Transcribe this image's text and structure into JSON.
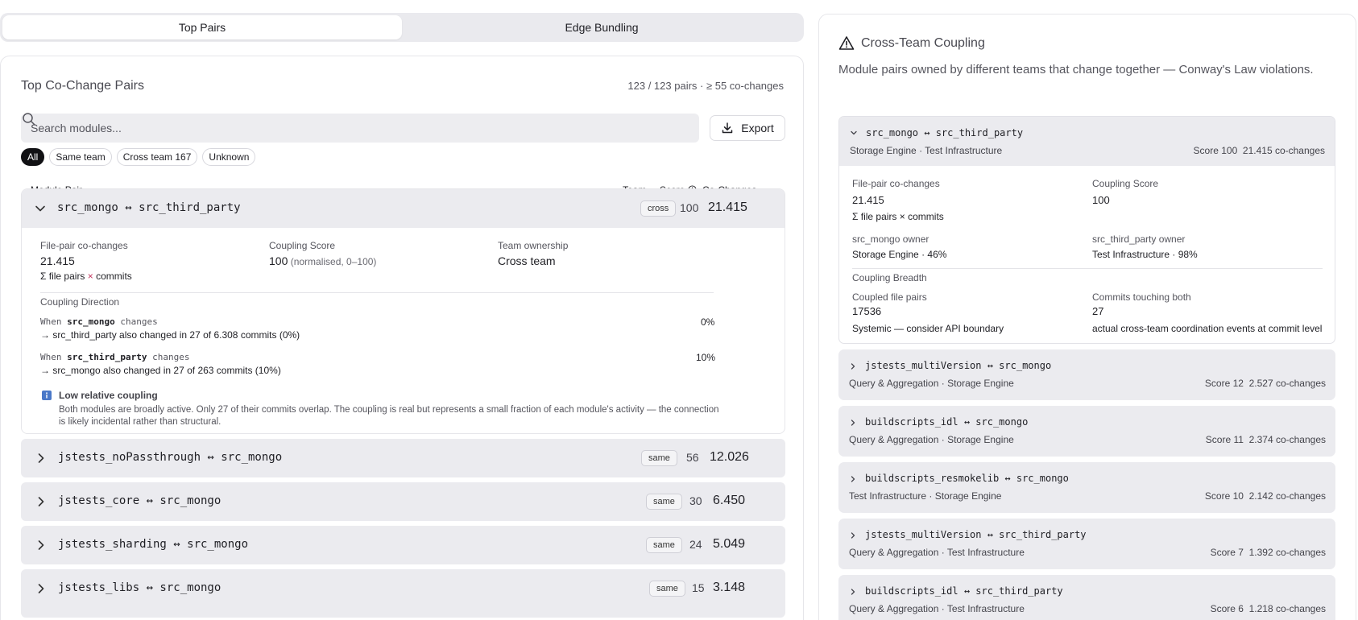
{
  "tabs": [
    {
      "label": "Top Pairs",
      "active": true
    },
    {
      "label": "Edge Bundling",
      "active": false
    }
  ],
  "main": {
    "title": "Top Co-Change Pairs",
    "meta": "123 / 123 pairs · ≥ 55 co-changes",
    "search_placeholder": "Search modules...",
    "export_label": "Export",
    "filters": [
      "All",
      "Same team",
      "Cross team 167",
      "Unknown"
    ],
    "columns": {
      "pair": "Module Pair",
      "team": "Team",
      "score": "Score",
      "cochanges": "Co-Changes"
    },
    "expanded": {
      "pair": "src_mongo ↔ src_third_party",
      "team": "cross",
      "score": "100",
      "cochanges": "21.415",
      "file_pair_label": "File-pair co-changes",
      "file_pair_value": "21.415",
      "file_pair_sub_a": "Σ file pairs ",
      "file_pair_sub_x": "×",
      "file_pair_sub_b": " commits",
      "coupling_label": "Coupling Score",
      "coupling_value": "100",
      "coupling_note": " (normalised, 0–100)",
      "ownership_label": "Team ownership",
      "ownership_value": "Cross team",
      "direction_label": "Coupling Direction",
      "dir1_when": "When ",
      "dir1_module": "src_mongo",
      "dir1_changes": " changes",
      "dir1_detail": "→ src_third_party also changed in 27 of 6.308 commits (0%)",
      "dir1_pct": "0%",
      "dir2_when": "When ",
      "dir2_module": "src_third_party",
      "dir2_changes": " changes",
      "dir2_detail": "→ src_mongo also changed in 27 of 263 commits (10%)",
      "dir2_pct": "10%",
      "note_title": "Low relative coupling",
      "note_body": "Both modules are broadly active. Only 27 of their commits overlap. The coupling is real but represents a small fraction of each module's activity — the connection is likely incidental rather than structural."
    },
    "rows": [
      {
        "pair": "jstests_noPassthrough ↔ src_mongo",
        "team": "same",
        "score": "56",
        "cochanges": "12.026"
      },
      {
        "pair": "jstests_core ↔ src_mongo",
        "team": "same",
        "score": "30",
        "cochanges": "6.450"
      },
      {
        "pair": "jstests_sharding ↔ src_mongo",
        "team": "same",
        "score": "24",
        "cochanges": "5.049"
      },
      {
        "pair": "jstests_libs ↔ src_mongo",
        "team": "same",
        "score": "15",
        "cochanges": "3.148"
      }
    ]
  },
  "cross_team": {
    "title": "Cross-Team Coupling",
    "description": "Module pairs owned by different teams that change together — Conway's Law violations.",
    "expanded": {
      "pair": "src_mongo ↔ src_third_party",
      "teams": "Storage Engine · Test Infrastructure",
      "score": "Score 100",
      "cochanges": "21.415 co-changes",
      "file_pair_label": "File-pair co-changes",
      "file_pair_value": "21.415",
      "file_pair_sub": "Σ file pairs × commits",
      "coupling_label": "Coupling Score",
      "coupling_value": "100",
      "owner1_label": "src_mongo owner",
      "owner1_value": "Storage Engine · 46%",
      "owner2_label": "src_third_party owner",
      "owner2_value": "Test Infrastructure · 98%",
      "breadth_label": "Coupling Breadth",
      "coupled_label": "Coupled file pairs",
      "coupled_value": "17536",
      "coupled_note": "Systemic — consider API boundary",
      "commits_label": "Commits touching both",
      "commits_value": "27",
      "commits_note": "actual cross-team coordination events at commit level"
    },
    "items": [
      {
        "pair": "jstests_multiVersion ↔ src_mongo",
        "teams": "Query & Aggregation · Storage Engine",
        "score": "Score 12",
        "cochanges": "2.527 co-changes"
      },
      {
        "pair": "buildscripts_idl ↔ src_mongo",
        "teams": "Query & Aggregation · Storage Engine",
        "score": "Score 11",
        "cochanges": "2.374 co-changes"
      },
      {
        "pair": "buildscripts_resmokelib ↔ src_mongo",
        "teams": "Test Infrastructure · Storage Engine",
        "score": "Score 10",
        "cochanges": "2.142 co-changes"
      },
      {
        "pair": "jstests_multiVersion ↔ src_third_party",
        "teams": "Query & Aggregation · Test Infrastructure",
        "score": "Score 7",
        "cochanges": "1.392 co-changes"
      },
      {
        "pair": "buildscripts_idl ↔ src_third_party",
        "teams": "Query & Aggregation · Test Infrastructure",
        "score": "Score 6",
        "cochanges": "1.218 co-changes"
      }
    ]
  }
}
